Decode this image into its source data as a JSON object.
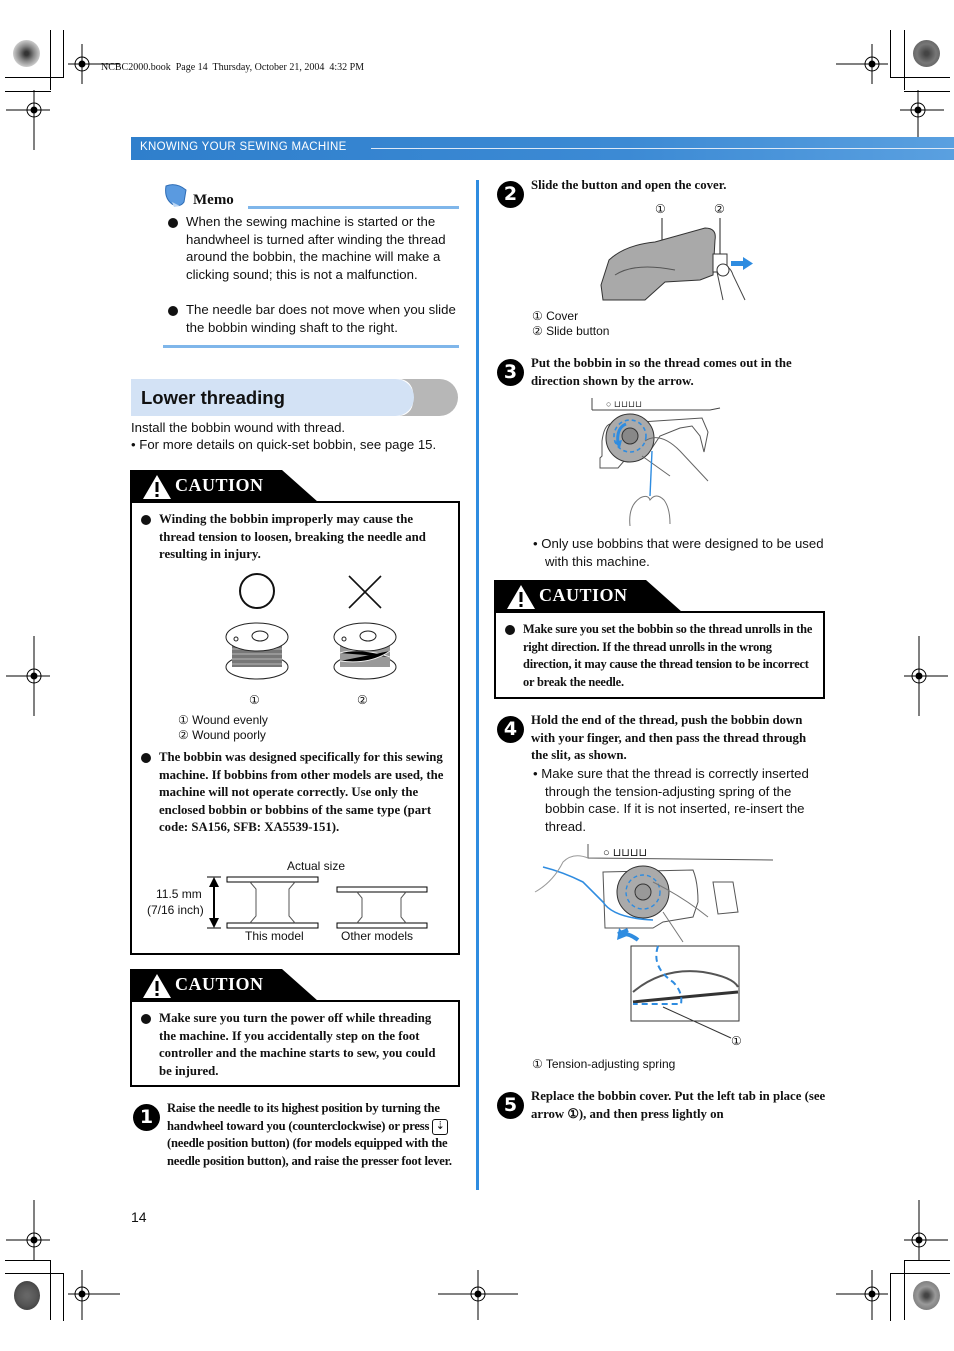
{
  "print_slug": "NCBC2000.book  Page 14  Thursday, October 21, 2004  4:32 PM",
  "header": {
    "section_title": "KNOWING YOUR SEWING MACHINE",
    "accent_color": "#2f7fcc"
  },
  "memo": {
    "title": "Memo",
    "items": [
      "When the sewing machine is started or the handwheel is turned after winding the thread around the bobbin, the machine will make a clicking sound; this is not a malfunction.",
      "The needle bar does not move when you slide the bobbin winding shaft to the right."
    ]
  },
  "section": {
    "title": "Lower threading",
    "intro": "Install the bobbin wound with thread.",
    "intro_note": "• For more details on quick-set bobbin, see page 15."
  },
  "caution_label": "CAUTION",
  "caution1": {
    "item1": "Winding the bobbin improperly may cause the thread tension to loosen, breaking the needle and resulting in injury.",
    "figure": {
      "good_symbol": "circle",
      "bad_symbol": "cross",
      "callout1": "①",
      "callout2": "②",
      "legend": [
        "① Wound evenly",
        "② Wound poorly"
      ]
    },
    "item2": "The bobbin was designed specifically for this sewing machine. If bobbins from other models are used, the machine will not operate correctly. Use only the enclosed bobbin or bobbins of the same type (part code: SA156, SFB: XA5539-151).",
    "size_figure": {
      "title": "Actual size",
      "dimension_mm": "11.5 mm",
      "dimension_in": "(7/16 inch)",
      "label_this": "This model",
      "label_other": "Other models"
    }
  },
  "caution2": {
    "item": "Make sure you turn the power off while threading the machine. If you accidentally step on the foot controller and the machine starts to sew, you could be injured."
  },
  "steps": [
    {
      "num": "1",
      "text_pre": "Raise the needle to its highest position by turning the handwheel toward you (counterclockwise) or press",
      "text_post": "(needle position button) (for models equipped with the needle position button), and raise the presser foot lever."
    },
    {
      "num": "2",
      "text": "Slide the button and open the cover.",
      "callouts": [
        "①",
        "②"
      ],
      "legend": [
        "① Cover",
        "② Slide button"
      ]
    },
    {
      "num": "3",
      "text": "Put the bobbin in so the thread comes out in the direction shown by the arrow.",
      "note": "• Only use bobbins that were designed to be used with this machine."
    },
    {
      "num": "4",
      "text": "Hold the end of the thread, push the bobbin down with your finger, and then pass the thread through the slit, as shown.",
      "note": "• Make sure that the thread is correctly inserted through the tension-adjusting spring of the bobbin case. If it is not inserted, re-insert the thread.",
      "callout": "①",
      "legend": "① Tension-adjusting spring"
    },
    {
      "num": "5",
      "text": "Replace the bobbin cover. Put the left tab in place (see arrow ①), and then press lightly on"
    }
  ],
  "caution3": {
    "item": "Make sure you set the bobbin so the thread unrolls in the right direction. If the thread unrolls in the wrong direction, it may cause the thread tension to be incorrect or break the needle."
  },
  "page_number": "14"
}
